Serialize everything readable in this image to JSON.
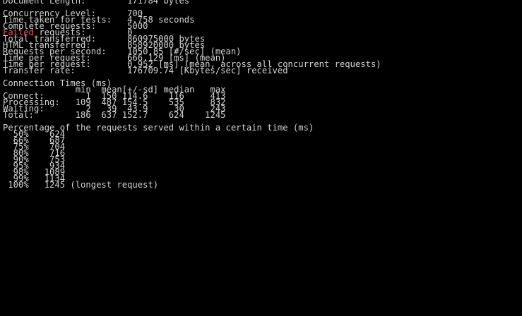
{
  "colors": {
    "background": "#000000",
    "text": "#d4d4d4",
    "failed": "#e05a5a"
  },
  "lines": [
    "Document Length:        171784 bytes",
    "",
    "Concurrency Level:      700",
    "Time taken for tests:   4.758 seconds",
    "Complete requests:      5000",
    "",
    "Total transferred:      860975000 bytes",
    "HTML transferred:       858920000 bytes",
    "Requests per second:    1050.85 [#/sec] (mean)",
    "Time per request:       666.129 [ms] (mean)",
    "Time per request:       0.952 [ms] (mean, across all concurrent requests)",
    "Transfer rate:          176709.74 [Kbytes/sec] received",
    "",
    "Connection Times (ms)",
    "              min  mean[+/-sd] median   max",
    "Connect:        1  150 114.6    116     413",
    "Processing:   109  487 154.5    535     832",
    "Waiting:        2   39  43.9     30     243",
    "Total:        186  637 152.7    624    1245",
    "",
    "Percentage of the requests served within a certain time (ms)",
    "  50%    624",
    "  66%    687",
    "  75%    704",
    "  80%    716",
    "  90%    753",
    "  95%    934",
    "  98%   1089",
    "  99%   1134",
    " 100%   1245 (longest request)"
  ],
  "failed_line": {
    "word": "Failed",
    "rest": " requests:        0"
  }
}
